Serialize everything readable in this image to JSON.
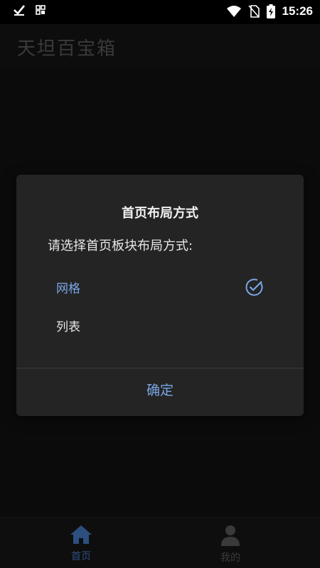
{
  "status_bar": {
    "time": "15:26",
    "icons": [
      "check-icon",
      "grid-icon",
      "wifi-icon",
      "no-sim-icon",
      "battery-charging-icon"
    ]
  },
  "app_bar": {
    "title": "天坦百宝箱"
  },
  "dialog": {
    "title": "首页布局方式",
    "message": "请选择首页板块布局方式:",
    "options": [
      {
        "label": "网格",
        "selected": true
      },
      {
        "label": "列表",
        "selected": false
      }
    ],
    "confirm_label": "确定"
  },
  "bottom_nav": {
    "items": [
      {
        "label": "首页",
        "icon": "home-icon",
        "active": true
      },
      {
        "label": "我的",
        "icon": "person-icon",
        "active": false
      }
    ]
  },
  "colors": {
    "accent": "#7aa6e6",
    "dialog_bg": "#242424",
    "scrim_bg": "#0b0b0b"
  }
}
